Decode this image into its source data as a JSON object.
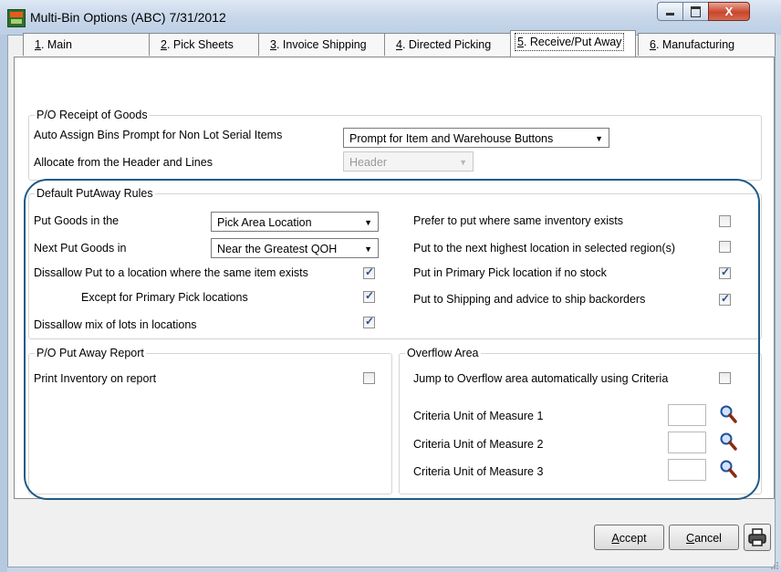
{
  "window": {
    "title": "Multi-Bin Options (ABC) 7/31/2012",
    "controls": {
      "minimize": "",
      "maximize": "",
      "close": "X"
    }
  },
  "tabs": [
    {
      "key": "1",
      "label": ". Main"
    },
    {
      "key": "2",
      "label": ". Pick Sheets"
    },
    {
      "key": "3",
      "label": ". Invoice Shipping"
    },
    {
      "key": "4",
      "label": ". Directed Picking"
    },
    {
      "key": "5",
      "label": ". Receive/Put Away",
      "active": true
    },
    {
      "key": "6",
      "label": ". Manufacturing"
    }
  ],
  "receipt": {
    "title": "P/O Receipt of Goods",
    "auto_assign_label": "Auto Assign Bins Prompt for Non Lot Serial Items",
    "auto_assign_value": "Prompt for Item and Warehouse Buttons",
    "allocate_label": "Allocate from the Header and Lines",
    "allocate_value": "Header"
  },
  "putaway": {
    "title": "Default PutAway Rules",
    "put_goods_label": "Put Goods in the",
    "put_goods_value": "Pick Area Location",
    "next_put_label": "Next Put Goods in",
    "next_put_value": "Near the Greatest QOH",
    "disallow_same_label": "Dissallow Put to a location where the same item exists",
    "disallow_same_checked": true,
    "except_primary_label": "Except for Primary Pick locations",
    "except_primary_checked": true,
    "disallow_mix_label": "Dissallow mix of lots in locations",
    "disallow_mix_checked": true,
    "prefer_same_label": "Prefer to put where same inventory exists",
    "prefer_same_checked": false,
    "next_highest_label": "Put to the next highest location in selected region(s)",
    "next_highest_checked": false,
    "primary_pick_label": "Put in Primary Pick location if no stock",
    "primary_pick_checked": true,
    "shipping_label": "Put to Shipping and advice to ship backorders",
    "shipping_checked": true
  },
  "report": {
    "title": "P/O Put Away Report",
    "print_inventory_label": "Print Inventory on report",
    "print_inventory_checked": false
  },
  "overflow": {
    "title": "Overflow Area",
    "jump_label": "Jump to Overflow area automatically using Criteria",
    "jump_checked": false,
    "uom1_label": "Criteria Unit of Measure 1",
    "uom1_value": "",
    "uom2_label": "Criteria Unit of Measure 2",
    "uom2_value": "",
    "uom3_label": "Criteria Unit of Measure 3",
    "uom3_value": ""
  },
  "buttons": {
    "accept_hotkey": "A",
    "accept_rest": "ccept",
    "cancel_hotkey": "C",
    "cancel_rest": "ancel"
  },
  "icons": {
    "app": "app-icon",
    "lookup": "magnifier-icon",
    "print": "printer-icon"
  },
  "colors": {
    "highlight_border": "#1e5a87",
    "titlebar": "#c9d8ea",
    "close_button": "#c9462c"
  }
}
